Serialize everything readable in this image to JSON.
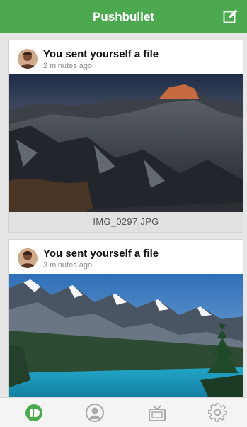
{
  "app": {
    "title": "Pushbullet"
  },
  "colors": {
    "accent": "#4ca94f",
    "inactive_icon": "#a9a9a9"
  },
  "toolbar": {
    "compose_icon": "compose-icon"
  },
  "feed": {
    "items": [
      {
        "headline": "You sent yourself a file",
        "time": "2 minutes ago",
        "file_name": "IMG_0297.JPG"
      },
      {
        "headline": "You sent yourself a file",
        "time": "3 minutes ago"
      }
    ]
  },
  "tabs": [
    {
      "icon": "pushes-icon",
      "active": true
    },
    {
      "icon": "friends-icon",
      "active": false
    },
    {
      "icon": "devices-icon",
      "active": false
    },
    {
      "icon": "settings-icon",
      "active": false
    }
  ]
}
